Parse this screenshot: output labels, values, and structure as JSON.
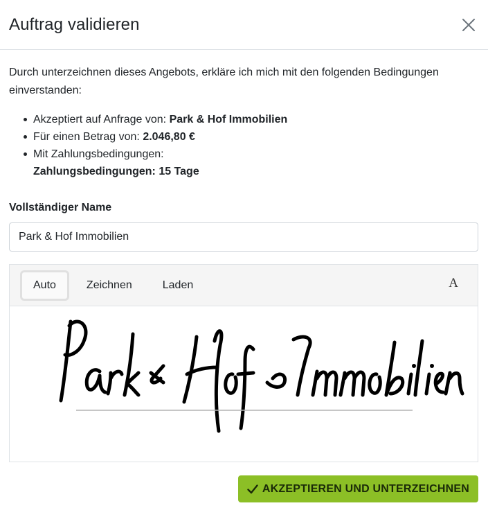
{
  "header": {
    "title": "Auftrag validieren",
    "close_icon": "close-icon"
  },
  "body": {
    "intro": "Durch unterzeichnen dieses Angebots, erkläre ich mich mit den folgenden Bedingungen einverstanden:",
    "terms": [
      {
        "label": "Akzeptiert auf Anfrage von: ",
        "value": "Park & Hof Immobilien"
      },
      {
        "label": "Für einen Betrag von: ",
        "value": "2.046,80 €"
      },
      {
        "label": "Mit Zahlungsbedingungen:",
        "value": "Zahlungsbedingungen: 15 Tage"
      }
    ]
  },
  "name_field": {
    "label": "Vollständiger Name",
    "value": "Park & Hof Immobilien"
  },
  "signature": {
    "tabs": [
      "Auto",
      "Zeichnen",
      "Laden"
    ],
    "active_tab": "Auto",
    "font_button": "A",
    "signed_text": "Park & Hof Immobilien"
  },
  "footer": {
    "accept_label": "AKZEPTIEREN UND UNTERZEICHNEN",
    "accept_icon": "check-icon",
    "accent_color": "#8cbf26"
  }
}
